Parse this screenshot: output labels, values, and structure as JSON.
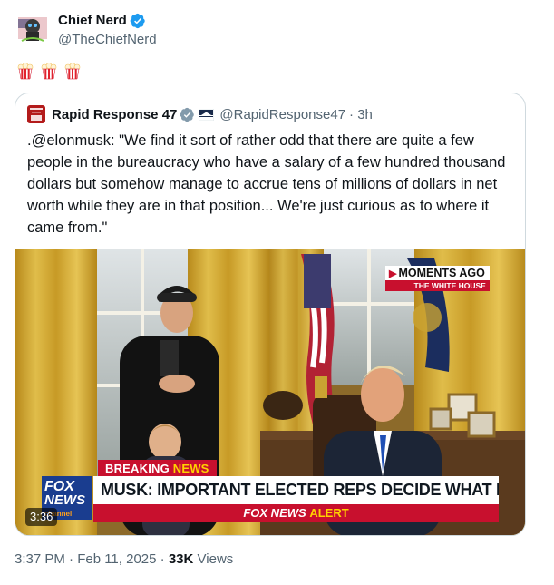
{
  "tweet": {
    "author_name": "Chief Nerd",
    "author_handle": "@TheChiefNerd",
    "emoji_text": "🍿🍿🍿",
    "timestamp": "3:37 PM · Feb 11, 2025",
    "separator": " · ",
    "views_count": "33K",
    "views_label": "Views"
  },
  "quote": {
    "author_name": "Rapid Response 47",
    "author_handle": "@RapidResponse47",
    "time": "· 3h",
    "text": ".@elonmusk: \"We find it sort of rather odd that there are quite a few people in the bureaucracy who have a salary of a few hundred thousand dollars but somehow manage to accrue tens of millions of dollars in net worth while they are in that position... We're just curious as to where it came from.\"",
    "video": {
      "duration": "3:36",
      "moments_label": "MOMENTS AGO",
      "moments_sub": "THE WHITE HOUSE",
      "breaking_label": "BREAKING",
      "breaking_news": "NEWS",
      "headline": "MUSK: IMPORTANT ELECTED REPS DECIDE WHAT HAPPENS",
      "alert_brand": "FOX NEWS",
      "alert_word": "ALERT",
      "logo_line1": "FOX",
      "logo_line2": "NEWS",
      "logo_line3": "channel"
    }
  },
  "colors": {
    "verified_blue": "#1d9bf0",
    "verified_gray": "#829aab",
    "secondary_text": "#536471",
    "border": "#cfd9de",
    "fox_red": "#c8102e"
  },
  "icons": {
    "verified": "verified-badge-icon",
    "affiliate": "gov-affiliate-badge-icon",
    "flag": "white-house-flag-icon"
  }
}
